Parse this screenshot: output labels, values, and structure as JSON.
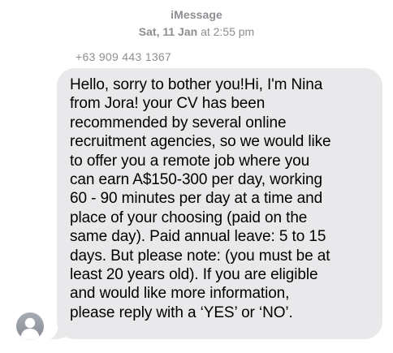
{
  "header": {
    "service": "iMessage",
    "timestamp_day": "Sat, 11 Jan",
    "timestamp_time": "at 2:55 pm"
  },
  "conversation": {
    "sender": "+63 909 443 1367",
    "message_lines": [
      "Hello, sorry to bother you!Hi, I'm Nina",
      "from Jora! your CV has been",
      "recommended by several online",
      "recruitment agencies, so we would like",
      "to offer you a remote job where you",
      "can earn A$150-300 per day, working",
      "60 - 90 minutes per day at a time and",
      "place of your choosing (paid on the",
      "same day). Paid annual leave: 5 to 15",
      "days. But please note: (you must be at",
      "least 20 years old). If you are eligible",
      "and would like more information,",
      "please reply with a ‘YES’ or ‘NO’."
    ]
  },
  "avatar": {
    "icon": "person-silhouette-icon"
  },
  "colors": {
    "bubble": "#e9e9eb",
    "meta_text": "#8e8e93",
    "avatar": "#8e929b"
  }
}
